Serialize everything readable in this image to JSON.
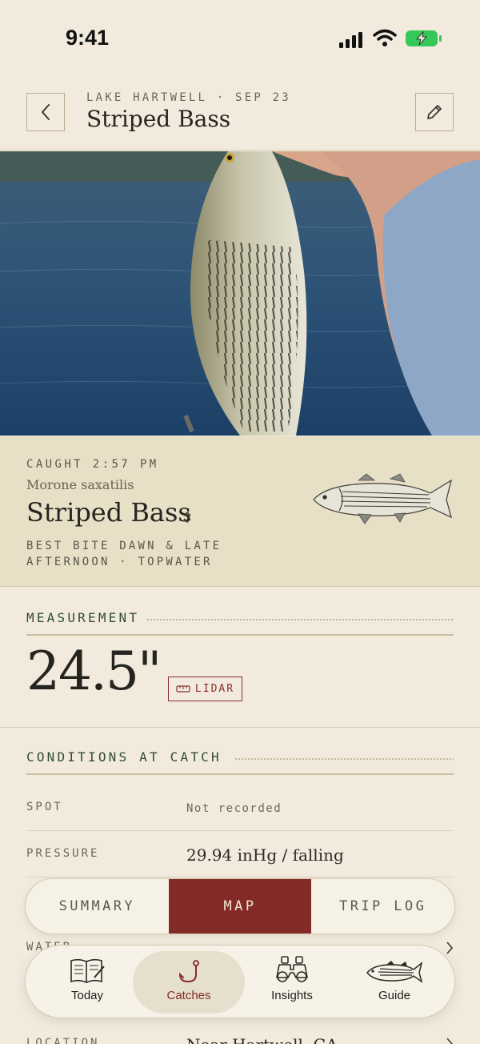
{
  "status_bar": {
    "time": "9:41"
  },
  "header": {
    "subtitle": "LAKE HARTWELL · SEP 23",
    "title": "Striped Bass"
  },
  "species_card": {
    "caught": "CAUGHT 2:57 PM",
    "latin_name": "Morone saxatilis",
    "common_name": "Striped Bass",
    "tip": "BEST BITE DAWN & LATE AFTERNOON · TOPWATER"
  },
  "measurement": {
    "heading": "MEASUREMENT",
    "value": "24.5\"",
    "badge": "LIDAR"
  },
  "conditions": {
    "heading": "CONDITIONS AT CATCH",
    "rows": [
      {
        "key": "SPOT",
        "value": "Not recorded"
      },
      {
        "key": "PRESSURE",
        "value": "29.94 inHg / falling"
      },
      {
        "key": "WATER",
        "value": ""
      },
      {
        "key": "LOCATION",
        "value": "Near Hartwell, GA"
      }
    ]
  },
  "segment": {
    "options": [
      "SUMMARY",
      "MAP",
      "TRIP LOG"
    ],
    "selected": "MAP"
  },
  "tabbar": {
    "tabs": [
      {
        "label": "Today",
        "icon": "book-icon"
      },
      {
        "label": "Catches",
        "icon": "hook-icon"
      },
      {
        "label": "Insights",
        "icon": "binoculars-icon"
      },
      {
        "label": "Guide",
        "icon": "fish-icon"
      }
    ],
    "active": "Catches"
  },
  "colors": {
    "background": "#f2ebdd",
    "card": "#e8dfc7",
    "accent": "#842a27",
    "section_green": "#2f4d35"
  }
}
